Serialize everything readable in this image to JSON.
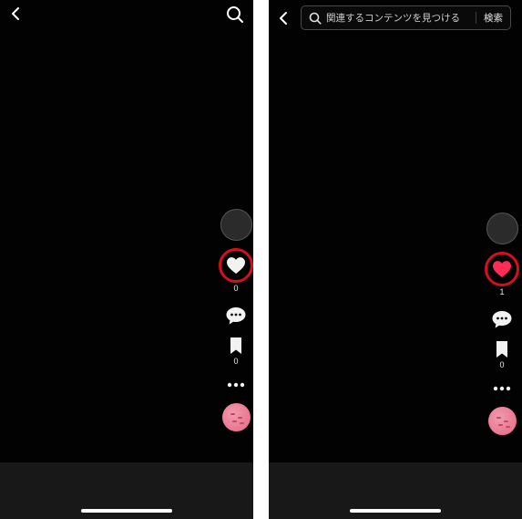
{
  "left_screen": {
    "like_count": "0",
    "bookmark_count": "0"
  },
  "right_screen": {
    "search": {
      "placeholder": "関連するコンテンツを見つける",
      "submit_label": "検索"
    },
    "like_count": "1",
    "bookmark_count": "0"
  },
  "colors": {
    "background": "#010101",
    "bottom_bar": "#181818",
    "highlight_ring": "#d3101c",
    "liked_heart": "#fe2c55",
    "music_disc": "#e9768f"
  },
  "icons": [
    "back-arrow-icon",
    "search-icon",
    "heart-icon",
    "comment-icon",
    "bookmark-icon",
    "more-icon",
    "music-disc-icon"
  ]
}
